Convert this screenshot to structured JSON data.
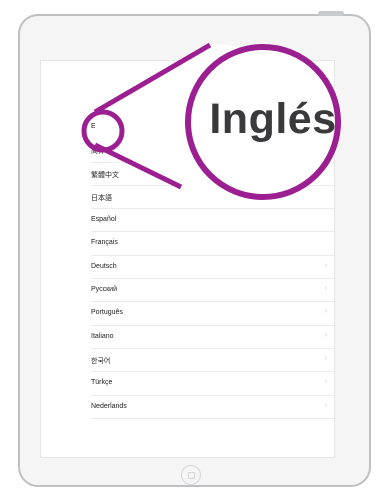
{
  "languages": [
    {
      "label": "English"
    },
    {
      "label": "简体中文"
    },
    {
      "label": "繁體中文"
    },
    {
      "label": "日本語"
    },
    {
      "label": "Español"
    },
    {
      "label": "Français"
    },
    {
      "label": "Deutsch"
    },
    {
      "label": "Русский"
    },
    {
      "label": "Português"
    },
    {
      "label": "Italiano"
    },
    {
      "label": "한국어"
    },
    {
      "label": "Türkçe"
    },
    {
      "label": "Nederlands"
    }
  ],
  "callout": {
    "label": "Inglés",
    "color": "#9c1f91"
  },
  "chevron_glyph": "›"
}
